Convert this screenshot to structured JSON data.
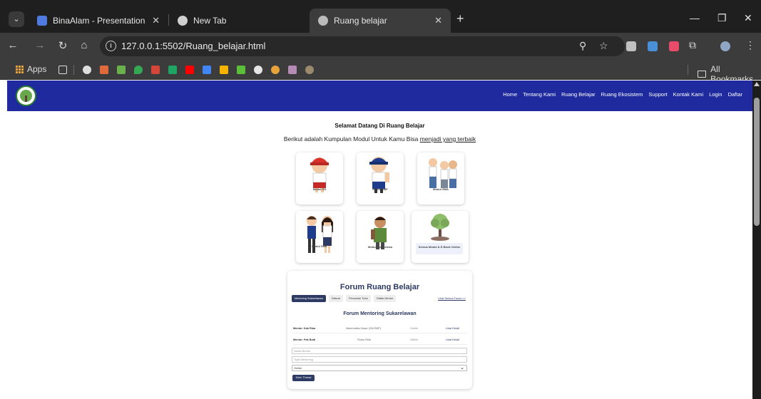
{
  "browser": {
    "tabs": [
      {
        "title": "BinaAlam - Presentation",
        "active": false
      },
      {
        "title": "New Tab",
        "active": false
      },
      {
        "title": "Ruang belajar",
        "active": true
      }
    ],
    "url": "127.0.0.1:5502/Ruang_belajar.html",
    "bookmarks": {
      "apps_label": "Apps",
      "all_bookmarks_label": "All Bookmarks"
    }
  },
  "site": {
    "nav": [
      "Home",
      "Tentang Kami",
      "Ruang Belajar",
      "Ruang Ekosistem",
      "Support",
      "Kontak Kami",
      "Login",
      "Daftar"
    ],
    "welcome_title": "Selamat Datang Di Ruang Belajar",
    "welcome_sub_plain": "Berikut adalah Kumpulan Modul Untuk Kamu Bisa ",
    "welcome_sub_link": "menjadi yang terbaik",
    "modules": [
      "Modul SD",
      "Modul SMP",
      "Modul SMA",
      "Modul SMK",
      "Modul Mahasiswa",
      "Semua Modul & E-Book Online"
    ],
    "forum": {
      "title": "Forum Ruang Belajar",
      "tabs": [
        "Mentoring Sukarelawan",
        "Diskusi",
        "Pencarian Tutor",
        "Daftar Mentor",
        "Lihat Semua Forum >>"
      ],
      "subtitle": "Forum Mentoring Sukarelawan",
      "mentors": [
        {
          "name": "Mentor: Kak Rina",
          "topic": "Matematika Dasar (SD/SMP)",
          "status": "Online",
          "detail": "Lihat Detail"
        },
        {
          "name": "Mentor: Pak Budi",
          "topic": "Fisika SMA",
          "status": "Offline",
          "detail": "Lihat Detail"
        }
      ],
      "name_placeholder": "Nama Mentor",
      "topic_placeholder": "Topik Mentoring",
      "status_value": "Online",
      "submit_label": "Kirim Thread"
    }
  },
  "colors": {
    "header_blue": "#1f2a9e",
    "forum_navy": "#2d3a63"
  }
}
